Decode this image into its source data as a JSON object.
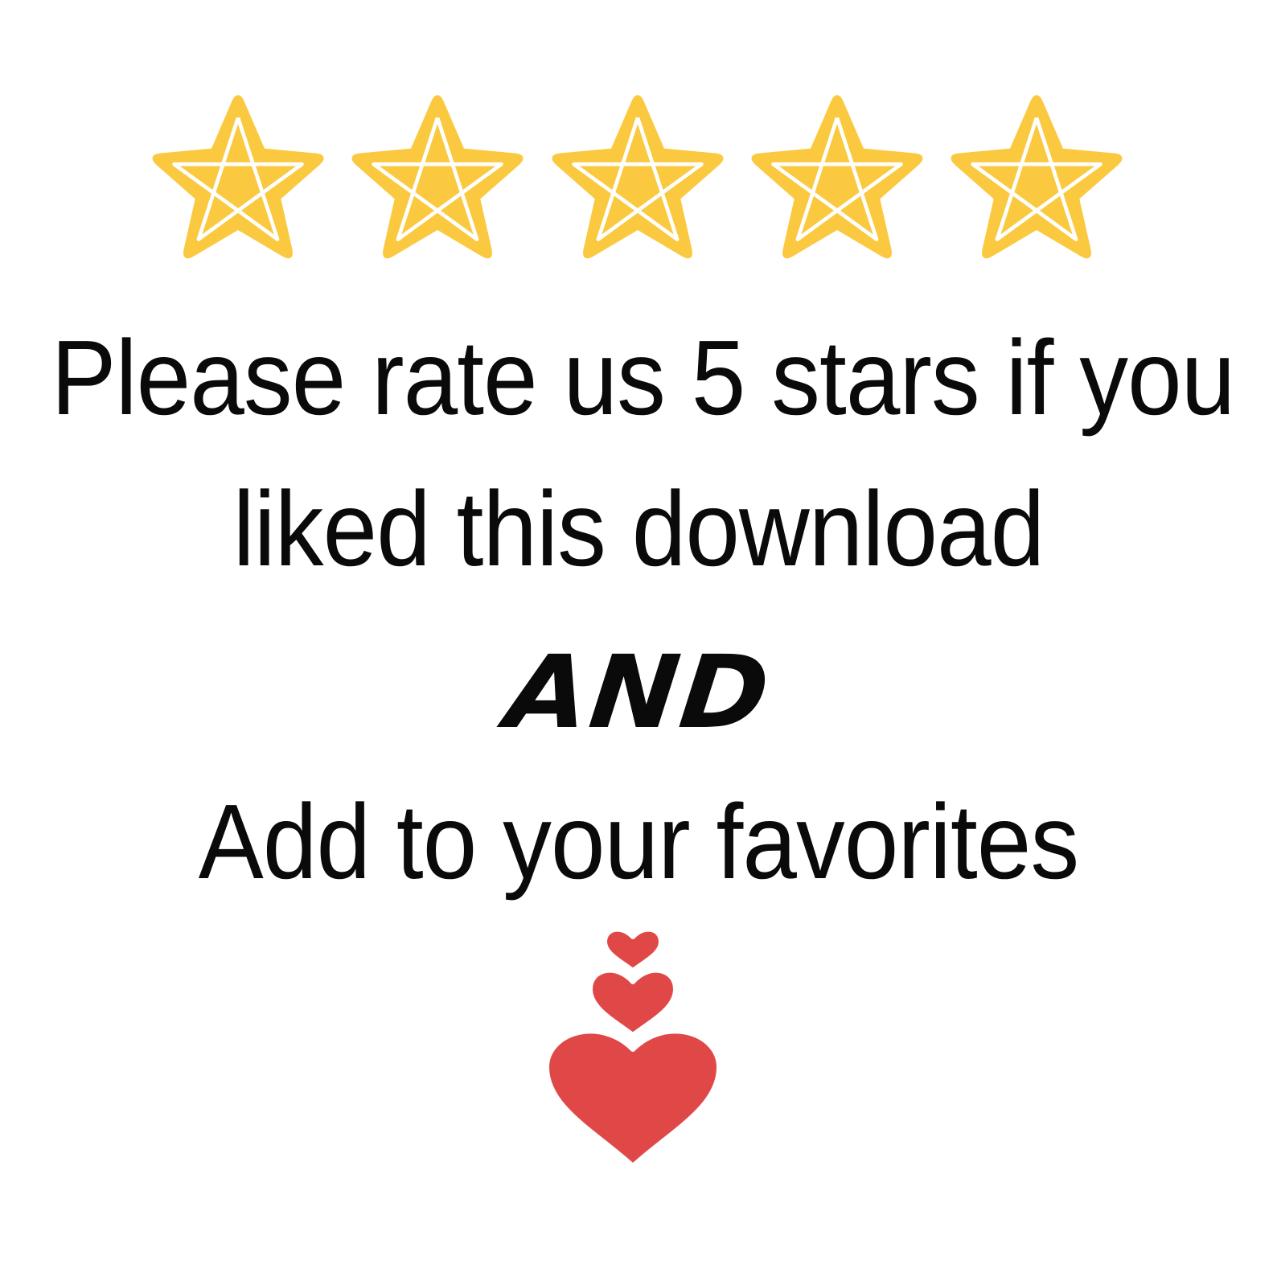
{
  "rating": {
    "stars_filled": 5,
    "stars_total": 5,
    "star_color": "#FBC940",
    "star_line_color": "#FFFFFF",
    "icon": "star-icon"
  },
  "message": {
    "line1": "Please rate us 5 stars if you",
    "line2": "liked this download",
    "conjunction": "AND",
    "line3": "Add to your favorites"
  },
  "decoration": {
    "icon": "hearts-icon",
    "heart_color": "#E04848",
    "heart_count": 3
  }
}
